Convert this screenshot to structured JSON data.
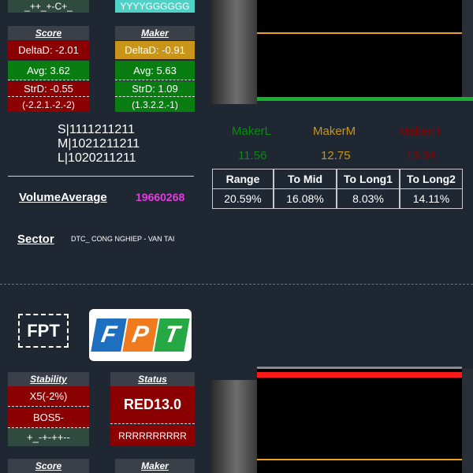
{
  "top": {
    "stability_signal": "_++_+-C+_",
    "status_signal": "YYYYGGGGGG"
  },
  "score_panel_1": {
    "header": "Score",
    "delta": "DeltaD: -2.01",
    "avg": "Avg: 3.62",
    "strd": "StrD: -0.55",
    "seq": "(-2.2.1.-2.-2)"
  },
  "maker_panel_1": {
    "header": "Maker",
    "delta": "DeltaD: -0.91",
    "avg": "Avg: 5.63",
    "strd": "StrD: 1.09",
    "seq": "(1.3.2.2.-1)"
  },
  "sml": {
    "s": "S|1111211211",
    "m": "M|1021211211",
    "l": "L|1020211211"
  },
  "volume_average": {
    "label": "VolumeAverage",
    "value": "19660268"
  },
  "sector": {
    "label": "Sector",
    "value": "DTC_ CONG NGHIEP - VAN TAI"
  },
  "makers": {
    "l_label": "MakerL",
    "l_value": "11.56",
    "m_label": "MakerM",
    "m_value": "12.75",
    "h_label": "MakerH",
    "h_value": "13.94",
    "colors": {
      "l": "#0a8a12",
      "m": "#c8951a",
      "h": "#8b0000"
    }
  },
  "metrics_table": {
    "headers": [
      "Range",
      "To Mid",
      "To Long1",
      "To Long2"
    ],
    "values": [
      "20.59%",
      "16.08%",
      "8.03%",
      "14.11%"
    ]
  },
  "ticker": "FPT",
  "logo": {
    "letters": [
      "F",
      "P",
      "T"
    ],
    "colors": [
      "#1e6fbf",
      "#f07b1f",
      "#26a844"
    ]
  },
  "stability_panel_2": {
    "header": "Stability",
    "line1": "X5(-2%)",
    "line2": "BOS5-",
    "signal": "+_-+-++--"
  },
  "status_panel_2": {
    "header": "Status",
    "main": "RED13.0",
    "seq": "RRRRRRRRRR"
  },
  "score_panel_2": {
    "header": "Score"
  },
  "maker_panel_2": {
    "header": "Maker"
  },
  "chart_colors": {
    "orange_line": "#e8a21e",
    "green_bar": "#16b12d",
    "red_bar": "#ff1a1a",
    "grey_line": "#8a8a8a"
  }
}
